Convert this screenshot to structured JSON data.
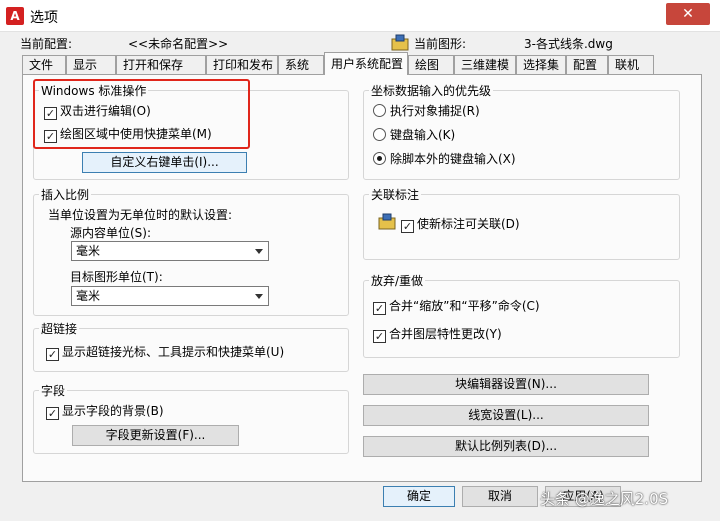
{
  "window": {
    "title": "选项",
    "close_glyph": "✕"
  },
  "header": {
    "current_profile_label": "当前配置:",
    "current_profile_value": "<<未命名配置>>",
    "current_drawing_label": "当前图形:",
    "current_drawing_value": "3-各式线条.dwg"
  },
  "tabs": [
    {
      "label": "文件"
    },
    {
      "label": "显示"
    },
    {
      "label": "打开和保存"
    },
    {
      "label": "打印和发布"
    },
    {
      "label": "系统"
    },
    {
      "label": "用户系统配置"
    },
    {
      "label": "绘图"
    },
    {
      "label": "三维建模"
    },
    {
      "label": "选择集"
    },
    {
      "label": "配置"
    },
    {
      "label": "联机"
    }
  ],
  "windows_ops": {
    "title": "Windows 标准操作",
    "double_click_edit": "双击进行编辑(O)",
    "shortcut_menu": "绘图区域中使用快捷菜单(M)",
    "right_click_button": "自定义右键单击(I)..."
  },
  "insert_scale": {
    "title": "插入比例",
    "subtitle": "当单位设置为无单位时的默认设置:",
    "source_label": "源内容单位(S):",
    "source_value": "毫米",
    "target_label": "目标图形单位(T):",
    "target_value": "毫米"
  },
  "hyperlink": {
    "title": "超链接",
    "show_cursor": "显示超链接光标、工具提示和快捷菜单(U)"
  },
  "fields": {
    "title": "字段",
    "show_background": "显示字段的背景(B)",
    "update_button": "字段更新设置(F)..."
  },
  "coord_priority": {
    "title": "坐标数据输入的优先级",
    "options": [
      {
        "label": "执行对象捕捉(R)",
        "selected": false
      },
      {
        "label": "键盘输入(K)",
        "selected": false
      },
      {
        "label": "除脚本外的键盘输入(X)",
        "selected": true
      }
    ]
  },
  "assoc_dim": {
    "title": "关联标注",
    "make_assoc": "使新标注可关联(D)"
  },
  "undo_redo": {
    "title": "放弃/重做",
    "combine_zoom": "合并“缩放”和“平移”命令(C)",
    "combine_layer": "合并图层特性更改(Y)"
  },
  "right_buttons": {
    "block_editor": "块编辑器设置(N)...",
    "lineweight": "线宽设置(L)...",
    "scale_list": "默认比例列表(D)..."
  },
  "footer": {
    "ok": "确定",
    "cancel": "取消",
    "apply": "应用(A)"
  },
  "watermark": "头条 @逸之风2.0S",
  "check_glyph": "✓",
  "colors": {
    "highlight": "#e0261b",
    "close_button": "#c7463b",
    "app_icon": "#d42121"
  }
}
